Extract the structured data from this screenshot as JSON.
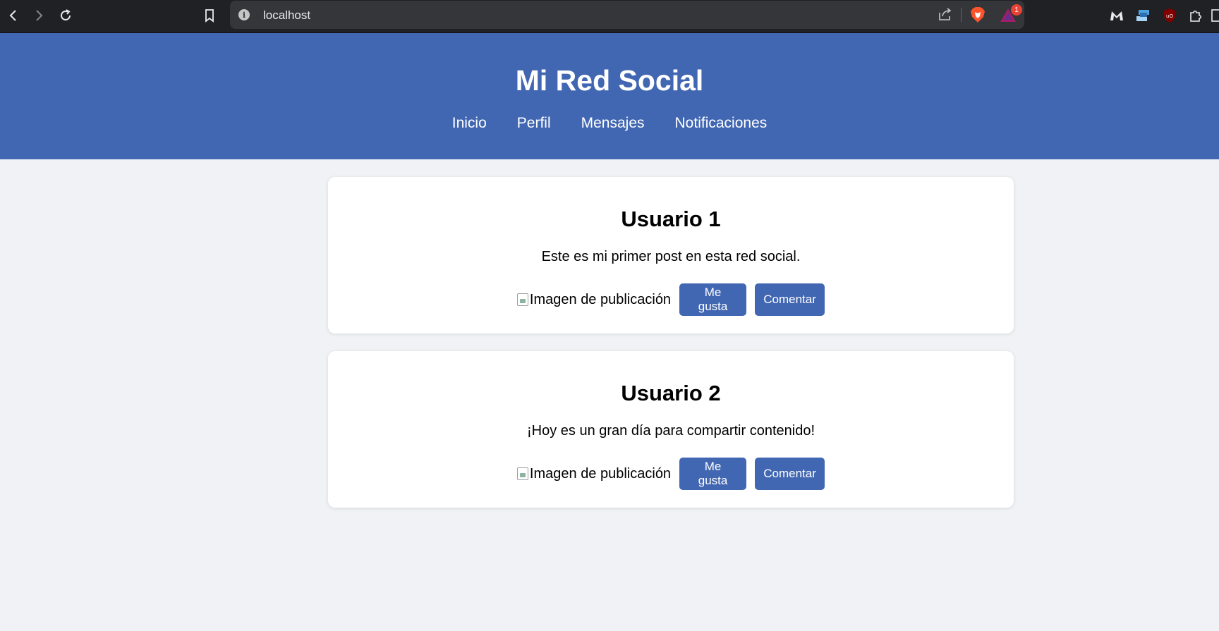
{
  "browser": {
    "url": "localhost",
    "badge_count": "1"
  },
  "site": {
    "title": "Mi Red Social",
    "nav": [
      "Inicio",
      "Perfil",
      "Mensajes",
      "Notificaciones"
    ]
  },
  "posts": [
    {
      "user": "Usuario 1",
      "text": "Este es mi primer post en esta red social.",
      "image_alt": "Imagen de publicación",
      "like_label": "Me gusta",
      "comment_label": "Comentar"
    },
    {
      "user": "Usuario 2",
      "text": "¡Hoy es un gran día para compartir contenido!",
      "image_alt": "Imagen de publicación",
      "like_label": "Me gusta",
      "comment_label": "Comentar"
    }
  ],
  "colors": {
    "brand": "#4267b2",
    "page_bg": "#f0f2f5",
    "chrome_bg": "#202124"
  },
  "icons": {
    "back": "chevron-left-icon",
    "forward": "chevron-right-icon",
    "reload": "reload-icon",
    "bookmark": "bookmark-icon",
    "info": "info-icon",
    "share": "share-icon",
    "brave": "brave-lion-icon",
    "rewards": "brave-rewards-icon",
    "malwarebytes": "malwarebytes-icon",
    "extension2": "stack-extension-icon",
    "ublock": "ublock-origin-icon",
    "extensions": "puzzle-icon"
  }
}
